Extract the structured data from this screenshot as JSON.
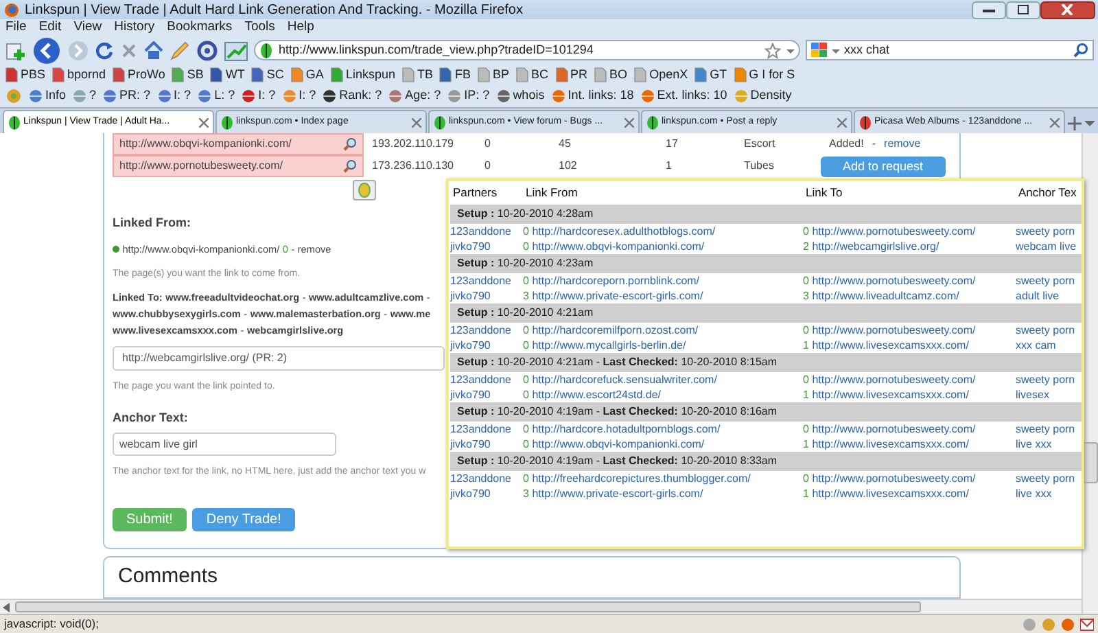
{
  "window": {
    "title": "Linkspun | View Trade | Adult Hard Link Generation And Tracking. - Mozilla Firefox"
  },
  "menu": [
    "File",
    "Edit",
    "View",
    "History",
    "Bookmarks",
    "Tools",
    "Help"
  ],
  "navigation": {
    "url": "http://www.linkspun.com/trade_view.php?tradeID=101294",
    "search": "xxx chat"
  },
  "bookmarks": [
    "PBS",
    "bpornd",
    "ProWo",
    "SB",
    "WT",
    "SC",
    "GA",
    "Linkspun",
    "TB",
    "FB",
    "BP",
    "BC",
    "PR",
    "BO",
    "OpenX",
    "GT",
    "G I for S"
  ],
  "seo_toolbar": [
    "Info",
    "?",
    "PR: ?",
    "I: ?",
    "L: ?",
    "I: ?",
    "I: ?",
    "Rank: ?",
    "Age: ?",
    "IP: ?",
    "whois",
    "Int. links: 18",
    "Ext. links: 10",
    "Density"
  ],
  "tabs": [
    {
      "label": "Linkspun | View Trade | Adult Ha...",
      "selected": true
    },
    {
      "label": "linkspun.com • Index page",
      "selected": false
    },
    {
      "label": "linkspun.com • View forum - Bugs ...",
      "selected": false
    },
    {
      "label": "linkspun.com • Post a reply",
      "selected": false
    },
    {
      "label": "Picasa Web Albums - 123anddone ...",
      "selected": false
    }
  ],
  "trades": [
    {
      "url": "http://www.obqvi-kompanionki.com/",
      "ip": "193.202.110.179",
      "column_3": "0",
      "column_4": "45",
      "column_5": "17",
      "category": "Escort",
      "kind": "added",
      "status": "Added!",
      "action": "remove"
    },
    {
      "url": "http://www.pornotubesweety.com/",
      "ip": "173.236.110.130",
      "column_3": "0",
      "column_4": "102",
      "column_5": "1",
      "category": "Tubes",
      "kind": "button",
      "action": "Add to request"
    }
  ],
  "form": {
    "linked_from_label": "Linked From:",
    "linked_from": {
      "url": "http://www.obqvi-kompanionki.com/",
      "count": "0",
      "action": "remove"
    },
    "linked_from_help": "The page(s) you want the link to come from.",
    "linked_to_label": "Linked To:",
    "linked_to_lines": [
      {
        "links": [
          "www.freeadultvideochat.org",
          "www.adultcamzlive.com"
        ],
        "trailing": true
      },
      {
        "links": [
          "www.chubbysexygirls.com",
          "www.malemasterbation.org",
          "www.me"
        ],
        "trailing": false
      },
      {
        "links": [
          "www.livesexcamsxxx.com",
          "webcamgirlslive.org"
        ],
        "trailing": false
      }
    ],
    "separator": "-",
    "target": "http://webcamgirlslive.org/ (PR: 2)",
    "target_help": "The page you want the link pointed to.",
    "anchor_label": "Anchor Text:",
    "anchor_value": "webcam live girl",
    "anchor_help": "The anchor text for the link, no HTML here, just add the anchor text you w",
    "buttons": [
      {
        "label": "Submit!",
        "kind": "submit"
      },
      {
        "label": "Deny Trade!",
        "kind": "deny"
      }
    ]
  },
  "popup": {
    "columns": [
      "Partners",
      "Link From",
      "Link To",
      "Anchor Tex"
    ],
    "groups": [
      {
        "setup": "**Setup :** 10-20-2010 4:28am",
        "rows": [
          {
            "partner": "123anddone",
            "from_count": "0",
            "from": "http://hardcoresex.adulthotblogs.com/",
            "to_count": "0",
            "to": "http://www.pornotubesweety.com/",
            "anchor": "sweety porn"
          },
          {
            "partner": "jivko790",
            "from_count": "0",
            "from": "http://www.obqvi-kompanionki.com/",
            "to_count": "2",
            "to": "http://webcamgirlslive.org/",
            "anchor": "webcam live"
          }
        ]
      },
      {
        "setup": "**Setup :** 10-20-2010 4:23am",
        "rows": [
          {
            "partner": "123anddone",
            "from_count": "0",
            "from": "http://hardcoreporn.pornblink.com/",
            "to_count": "0",
            "to": "http://www.pornotubesweety.com/",
            "anchor": "sweety porn"
          },
          {
            "partner": "jivko790",
            "from_count": "3",
            "from": "http://www.private-escort-girls.com/",
            "to_count": "3",
            "to": "http://www.liveadultcamz.com/",
            "anchor": "adult live"
          }
        ]
      },
      {
        "setup": "**Setup :** 10-20-2010 4:21am",
        "rows": [
          {
            "partner": "123anddone",
            "from_count": "0",
            "from": "http://hardcoremilfporn.ozost.com/",
            "to_count": "0",
            "to": "http://www.pornotubesweety.com/",
            "anchor": "sweety porn"
          },
          {
            "partner": "jivko790",
            "from_count": "0",
            "from": "http://www.mycallgirls-berlin.de/",
            "to_count": "1",
            "to": "http://www.livesexcamsxxx.com/",
            "anchor": "xxx cam"
          }
        ]
      },
      {
        "setup": "**Setup :** 10-20-2010 4:21am - **Last Checked:** 10-20-2010 8:15am",
        "rows": [
          {
            "partner": "123anddone",
            "from_count": "0",
            "from": "http://hardcorefuck.sensualwriter.com/",
            "to_count": "0",
            "to": "http://www.pornotubesweety.com/",
            "anchor": "sweety porn"
          },
          {
            "partner": "jivko790",
            "from_count": "0",
            "from": "http://www.escort24std.de/",
            "to_count": "1",
            "to": "http://www.livesexcamsxxx.com/",
            "anchor": "livesex"
          }
        ]
      },
      {
        "setup": "**Setup :** 10-20-2010 4:19am - **Last Checked:** 10-20-2010 8:16am",
        "rows": [
          {
            "partner": "123anddone",
            "from_count": "0",
            "from": "http://hardcore.hotadultpornblogs.com/",
            "to_count": "0",
            "to": "http://www.pornotubesweety.com/",
            "anchor": "sweety porn"
          },
          {
            "partner": "jivko790",
            "from_count": "0",
            "from": "http://www.obqvi-kompanionki.com/",
            "to_count": "1",
            "to": "http://www.livesexcamsxxx.com/",
            "anchor": "live xxx"
          }
        ]
      },
      {
        "setup": "**Setup :** 10-20-2010 4:19am - **Last Checked:** 10-20-2010 8:33am",
        "rows": [
          {
            "partner": "123anddone",
            "from_count": "0",
            "from": "http://freehardcorepictures.thumblogger.com/",
            "to_count": "0",
            "to": "http://www.pornotubesweety.com/",
            "anchor": "sweety porn"
          },
          {
            "partner": "jivko790",
            "from_count": "3",
            "from": "http://www.private-escort-girls.com/",
            "to_count": "1",
            "to": "http://www.livesexcamsxxx.com/",
            "anchor": "live xxx"
          }
        ]
      }
    ]
  },
  "comments": {
    "title": "Comments"
  },
  "status_bar": "javascript: void(0);"
}
